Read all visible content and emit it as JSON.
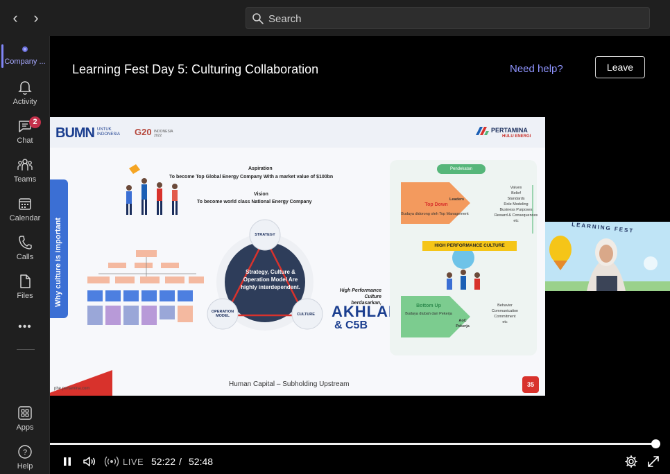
{
  "topbar": {
    "back_label": "‹",
    "forward_label": "›",
    "search_label": "Search"
  },
  "rail": {
    "items": [
      {
        "label": "Company ...",
        "active": true
      },
      {
        "label": "Activity"
      },
      {
        "label": "Chat",
        "badge": "2"
      },
      {
        "label": "Teams"
      },
      {
        "label": "Calendar"
      },
      {
        "label": "Calls"
      },
      {
        "label": "Files"
      },
      {
        "label": "•••"
      },
      {
        "label": "Apps"
      },
      {
        "label": "Help"
      }
    ]
  },
  "meeting": {
    "title": "Learning Fest Day 5: Culturing Collaboration",
    "help_link": "Need help?",
    "leave_label": "Leave"
  },
  "slide": {
    "bumn": "BUMN",
    "bumn_sub": "UNTUK INDONESIA",
    "g20": "G20",
    "g20_sub": "INDONESIA 2022",
    "pertamina": "PERTAMINA",
    "pertamina_sub": "HULU ENERGI",
    "side_tab": "Why culture is important",
    "aspiration_title": "Aspiration",
    "aspiration_text": "To become Top Global Energy Company With a market value of $100bn",
    "vision_title": "Vision",
    "vision_text": "To become world class National Energy Company",
    "triangle": {
      "strategy": "STRATEGY",
      "operation": "OPERATION MODEL",
      "culture": "CULTURE",
      "center": "Strategy, Culture & Operation Model Are highly interdependent."
    },
    "hpc_text": "High Performance Culture berdasarkan,",
    "akhlak": "AKHLAK",
    "c5b": "& C5B",
    "panel": {
      "title": "Pendekatan",
      "top_down": "Top Down",
      "top_down_desc": "Budaya didorong oleh Top Management",
      "leaders": "Leaders",
      "values": "Values\nBelief\nStandards\nRole Modeling\nBusiness Purposes\nReward & Consequences\netc",
      "hpc_box": "HIGH PERFORMANCE CULTURE",
      "bottom_up": "Bottom Up",
      "bottom_up_desc": "Budaya diubah dari Pekerja",
      "aoc": "AoC Pekerja",
      "behavior": "Behavior\nCommunication\nCommitment\netc"
    },
    "footer_text": "Human Capital – Subholding Upstream",
    "footer_url": "phe.pertamina.com",
    "badge": "35"
  },
  "participant": {
    "banner": "LEARNING FEST"
  },
  "controls": {
    "live_label": "LIVE",
    "time_current": "52:22",
    "time_separator": "/",
    "time_total": "52:48",
    "progress": 0.992
  },
  "colors": {
    "accent": "#7f85f5",
    "badge": "#c4314b",
    "link": "#8f94ff"
  }
}
